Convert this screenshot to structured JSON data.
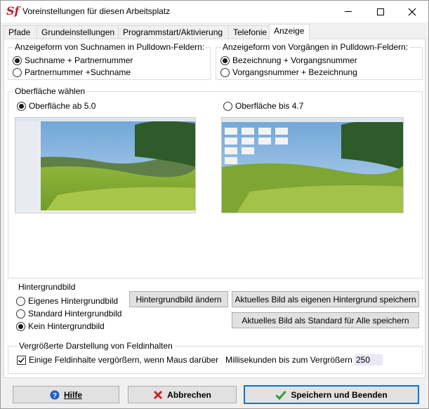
{
  "window": {
    "title": "Voreinstellungen für diesen Arbeitsplatz",
    "app_icon_text": "Sf"
  },
  "tabs": [
    {
      "label": "Pfade",
      "active": false
    },
    {
      "label": "Grundeinstellungen",
      "active": false
    },
    {
      "label": "Programmstart/Aktivierung",
      "active": false
    },
    {
      "label": "Telefonie",
      "active": false
    },
    {
      "label": "Anzeige",
      "active": true
    }
  ],
  "suchnamen": {
    "legend": "Anzeigeform von Suchnamen in Pulldown-Feldern:",
    "options": [
      {
        "label": "Suchname + Partnernummer",
        "checked": true
      },
      {
        "label": "Partnernummer +Suchname",
        "checked": false
      }
    ]
  },
  "vorgaenge": {
    "legend": "Anzeigeform von Vorgängen in Pulldown-Feldern:",
    "options": [
      {
        "label": "Bezeichnung + Vorgangsnummer",
        "checked": true
      },
      {
        "label": "Vorgangsnummer + Bezeichnung",
        "checked": false
      }
    ]
  },
  "oberflaeche": {
    "legend": "Oberfläche wählen",
    "options": [
      {
        "label": "Oberfläche ab 5.0",
        "checked": true
      },
      {
        "label": "Oberfläche bis 4.7",
        "checked": false
      }
    ]
  },
  "hintergrund": {
    "legend": "Hintergrundbild",
    "options": [
      {
        "label": "Eigenes Hintergrundbild",
        "checked": false
      },
      {
        "label": "Standard Hintergrundbild",
        "checked": false
      },
      {
        "label": "Kein Hintergrundbild",
        "checked": true
      }
    ],
    "btn_change": "Hintergrundbild ändern",
    "btn_save_own": "Aktuelles Bild als eigenen Hintergrund speichern",
    "btn_save_standard": "Aktuelles Bild als Standard für Alle speichern"
  },
  "vergroesserung": {
    "legend": "Vergrößerte Darstellung von Feldinhalten",
    "checkbox_label": "Einige Feldinhalte vergörßern, wenn Maus darüber",
    "checked": true,
    "ms_label": "Millisekunden bis zum Vergrößern",
    "ms_value": "250"
  },
  "footer": {
    "help": "Hilfe",
    "cancel": "Abbrechen",
    "save": "Speichern und Beenden"
  },
  "colors": {
    "accent": "#0078d7",
    "cancel_icon": "#c0262d",
    "save_icon": "#2e9e3a",
    "help_icon": "#1f5fbf"
  }
}
